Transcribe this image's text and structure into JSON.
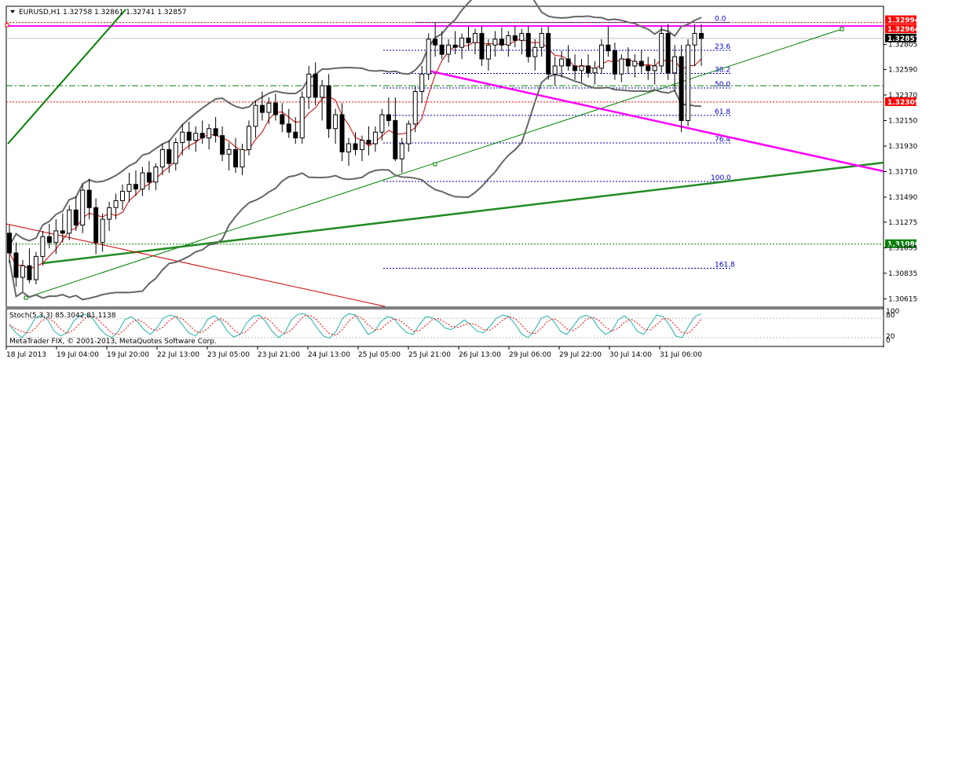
{
  "header": {
    "symbol_line": "EURUSD,H1  1.32758 1.32861 1.32741 1.32857",
    "collapse_arrow": "triangle-down-icon"
  },
  "footer": {
    "copyright": "MetaTrader FIX, © 2001-2013, MetaQuotes Software Corp."
  },
  "oscillator": {
    "label": "Stoch(5,3,3) 85.3042 81.1138",
    "levels": [
      "100",
      "80",
      "20",
      "0"
    ],
    "k_color": "#20b2aa",
    "d_color": "#ff0000",
    "k_values": [
      60,
      35,
      20,
      45,
      80,
      90,
      75,
      40,
      25,
      35,
      70,
      88,
      92,
      80,
      50,
      30,
      20,
      40,
      75,
      85,
      70,
      45,
      30,
      50,
      80,
      90,
      85,
      60,
      35,
      25,
      45,
      78,
      88,
      72,
      40,
      22,
      30,
      65,
      85,
      90,
      70,
      40,
      20,
      35,
      75,
      92,
      95,
      80,
      50,
      25,
      18,
      40,
      80,
      95,
      90,
      60,
      30,
      40,
      70,
      85,
      80,
      55,
      35,
      30,
      60,
      85,
      82,
      70,
      50,
      45,
      60,
      75,
      60,
      40,
      35,
      55,
      80,
      90,
      85,
      60,
      30,
      20,
      45,
      80,
      88,
      70,
      40,
      30,
      55,
      82,
      90,
      80,
      50,
      30,
      40,
      75,
      88,
      70,
      40,
      30,
      60,
      90,
      85,
      60,
      25,
      20,
      55,
      85,
      95
    ]
  },
  "chart_data": {
    "type": "candlestick",
    "title": "EURUSD,H1",
    "ohlc_readout": {
      "open": 1.32758,
      "high": 1.32861,
      "low": 1.32741,
      "close": 1.32857
    },
    "ylim": [
      1.3055,
      1.3312
    ],
    "y_ticks": [
      "1.32805",
      "1.32590",
      "1.32370",
      "1.32150",
      "1.31930",
      "1.31710",
      "1.31490",
      "1.31275",
      "1.31055",
      "1.30835",
      "1.30615"
    ],
    "x_ticks": [
      "18 Jul 2013",
      "19 Jul 04:00",
      "19 Jul 20:00",
      "22 Jul 13:00",
      "23 Jul 05:00",
      "23 Jul 21:00",
      "24 Jul 13:00",
      "25 Jul 05:00",
      "25 Jul 21:00",
      "26 Jul 13:00",
      "29 Jul 06:00",
      "29 Jul 22:00",
      "30 Jul 14:00",
      "31 Jul 06:00"
    ],
    "price_badges": [
      {
        "label": "1.32994",
        "value": 1.32994,
        "color": "#ff0000"
      },
      {
        "label": "1.32964",
        "value": 1.32964,
        "color": "#ff0000"
      },
      {
        "label": "1.32857",
        "value": 1.32857,
        "color": "#000000"
      },
      {
        "label": "1.32309",
        "value": 1.32309,
        "color": "#ff0000"
      },
      {
        "label": "1.31086",
        "value": 1.31086,
        "color": "#008000"
      }
    ],
    "horizontal_lines": [
      {
        "value": 1.32964,
        "color": "#ff00ff",
        "style": "solid",
        "width": 2
      },
      {
        "value": 1.32994,
        "color": "#ff0000",
        "style": "dotted",
        "width": 1
      },
      {
        "value": 1.32309,
        "color": "#ff0000",
        "style": "dotted",
        "width": 1
      },
      {
        "value": 1.3245,
        "color": "#008000",
        "style": "dashdot",
        "width": 1
      },
      {
        "value": 1.31086,
        "color": "#008000",
        "style": "dotted",
        "width": 1
      },
      {
        "value": 1.32857,
        "color": "#c0c0c0",
        "style": "solid",
        "width": 1
      }
    ],
    "fibonacci_levels": [
      {
        "label": "0.0",
        "value": 1.32994
      },
      {
        "label": "23.6",
        "value": 1.32755
      },
      {
        "label": "38.2",
        "value": 1.32555
      },
      {
        "label": "50.0",
        "value": 1.3243
      },
      {
        "label": "61.8",
        "value": 1.32194
      },
      {
        "label": "76.4",
        "value": 1.31957
      },
      {
        "label": "100.0",
        "value": 1.31625
      },
      {
        "label": "161.8",
        "value": 1.30878
      }
    ],
    "candles": [
      [
        1.3118,
        1.3125,
        1.3092,
        1.3101
      ],
      [
        1.3101,
        1.311,
        1.3072,
        1.308
      ],
      [
        1.308,
        1.3095,
        1.3068,
        1.309
      ],
      [
        1.309,
        1.3105,
        1.3075,
        1.3078
      ],
      [
        1.3078,
        1.3102,
        1.3074,
        1.3098
      ],
      [
        1.3098,
        1.312,
        1.309,
        1.3115
      ],
      [
        1.3115,
        1.3126,
        1.3105,
        1.311
      ],
      [
        1.311,
        1.313,
        1.31,
        1.312
      ],
      [
        1.312,
        1.3135,
        1.311,
        1.3118
      ],
      [
        1.3118,
        1.3142,
        1.3112,
        1.3138
      ],
      [
        1.3138,
        1.315,
        1.312,
        1.3125
      ],
      [
        1.3125,
        1.316,
        1.3118,
        1.3155
      ],
      [
        1.3155,
        1.3165,
        1.313,
        1.314
      ],
      [
        1.314,
        1.3148,
        1.31,
        1.311
      ],
      [
        1.311,
        1.3135,
        1.3102,
        1.313
      ],
      [
        1.313,
        1.3145,
        1.312,
        1.314
      ],
      [
        1.314,
        1.3152,
        1.313,
        1.3146
      ],
      [
        1.3146,
        1.316,
        1.3138,
        1.3154
      ],
      [
        1.3154,
        1.317,
        1.3145,
        1.316
      ],
      [
        1.316,
        1.3172,
        1.315,
        1.3156
      ],
      [
        1.3156,
        1.3175,
        1.315,
        1.317
      ],
      [
        1.317,
        1.318,
        1.3155,
        1.3162
      ],
      [
        1.3162,
        1.3178,
        1.3155,
        1.3175
      ],
      [
        1.3175,
        1.3195,
        1.3168,
        1.319
      ],
      [
        1.319,
        1.3198,
        1.317,
        1.3178
      ],
      [
        1.3178,
        1.32,
        1.3172,
        1.3196
      ],
      [
        1.3196,
        1.3212,
        1.3185,
        1.3205
      ],
      [
        1.3205,
        1.3214,
        1.319,
        1.3198
      ],
      [
        1.3198,
        1.321,
        1.3188,
        1.3204
      ],
      [
        1.3204,
        1.3215,
        1.3195,
        1.32
      ],
      [
        1.32,
        1.3212,
        1.319,
        1.3208
      ],
      [
        1.3208,
        1.3218,
        1.3196,
        1.3202
      ],
      [
        1.3202,
        1.321,
        1.318,
        1.3186
      ],
      [
        1.3186,
        1.3196,
        1.3172,
        1.319
      ],
      [
        1.319,
        1.32,
        1.317,
        1.3175
      ],
      [
        1.3175,
        1.3195,
        1.3168,
        1.319
      ],
      [
        1.319,
        1.3215,
        1.3185,
        1.321
      ],
      [
        1.321,
        1.3232,
        1.32,
        1.3228
      ],
      [
        1.3228,
        1.324,
        1.3215,
        1.3222
      ],
      [
        1.3222,
        1.3235,
        1.3212,
        1.323
      ],
      [
        1.323,
        1.3238,
        1.3215,
        1.322
      ],
      [
        1.322,
        1.323,
        1.3205,
        1.3212
      ],
      [
        1.3212,
        1.3225,
        1.32,
        1.3205
      ],
      [
        1.3205,
        1.3218,
        1.3195,
        1.32
      ],
      [
        1.32,
        1.324,
        1.3195,
        1.3235
      ],
      [
        1.3235,
        1.3262,
        1.3225,
        1.3255
      ],
      [
        1.3255,
        1.3265,
        1.3228,
        1.3235
      ],
      [
        1.3235,
        1.325,
        1.3215,
        1.3245
      ],
      [
        1.3245,
        1.3255,
        1.32,
        1.3208
      ],
      [
        1.3208,
        1.3225,
        1.3195,
        1.322
      ],
      [
        1.322,
        1.323,
        1.318,
        1.3188
      ],
      [
        1.3188,
        1.32,
        1.3176,
        1.3195
      ],
      [
        1.3195,
        1.3205,
        1.3185,
        1.319
      ],
      [
        1.319,
        1.3202,
        1.318,
        1.3198
      ],
      [
        1.3198,
        1.321,
        1.3185,
        1.3195
      ],
      [
        1.3195,
        1.321,
        1.3188,
        1.3205
      ],
      [
        1.3205,
        1.3225,
        1.3198,
        1.322
      ],
      [
        1.322,
        1.3235,
        1.321,
        1.3215
      ],
      [
        1.3215,
        1.3235,
        1.318,
        1.3182
      ],
      [
        1.3182,
        1.32,
        1.317,
        1.3195
      ],
      [
        1.3195,
        1.3215,
        1.3188,
        1.3212
      ],
      [
        1.3212,
        1.3245,
        1.3205,
        1.324
      ],
      [
        1.324,
        1.3262,
        1.323,
        1.3255
      ],
      [
        1.3255,
        1.329,
        1.325,
        1.3285
      ],
      [
        1.3285,
        1.3299,
        1.327,
        1.328
      ],
      [
        1.328,
        1.3292,
        1.3268,
        1.3272
      ],
      [
        1.3272,
        1.3285,
        1.3265,
        1.328
      ],
      [
        1.328,
        1.3292,
        1.3272,
        1.3278
      ],
      [
        1.3278,
        1.329,
        1.3268,
        1.3286
      ],
      [
        1.3286,
        1.3296,
        1.3276,
        1.3282
      ],
      [
        1.3282,
        1.3294,
        1.3272,
        1.329
      ],
      [
        1.329,
        1.3296,
        1.3262,
        1.3268
      ],
      [
        1.3268,
        1.3285,
        1.3258,
        1.328
      ],
      [
        1.328,
        1.3292,
        1.327,
        1.3285
      ],
      [
        1.3285,
        1.3295,
        1.3275,
        1.328
      ],
      [
        1.328,
        1.3292,
        1.327,
        1.3288
      ],
      [
        1.3288,
        1.3296,
        1.3278,
        1.3284
      ],
      [
        1.3284,
        1.3294,
        1.3272,
        1.329
      ],
      [
        1.329,
        1.3296,
        1.3265,
        1.327
      ],
      [
        1.327,
        1.3285,
        1.3258,
        1.3278
      ],
      [
        1.3278,
        1.3295,
        1.327,
        1.329
      ],
      [
        1.329,
        1.3296,
        1.325,
        1.3255
      ],
      [
        1.3255,
        1.327,
        1.3245,
        1.3262
      ],
      [
        1.3262,
        1.3275,
        1.3252,
        1.3268
      ],
      [
        1.3268,
        1.328,
        1.3258,
        1.3262
      ],
      [
        1.3262,
        1.3272,
        1.325,
        1.3258
      ],
      [
        1.3258,
        1.3268,
        1.3248,
        1.3262
      ],
      [
        1.3262,
        1.3272,
        1.3252,
        1.3256
      ],
      [
        1.3256,
        1.3266,
        1.3246,
        1.326
      ],
      [
        1.326,
        1.3285,
        1.3255,
        1.328
      ],
      [
        1.328,
        1.3296,
        1.327,
        1.3275
      ],
      [
        1.3275,
        1.3282,
        1.325,
        1.3255
      ],
      [
        1.3255,
        1.3272,
        1.3248,
        1.3268
      ],
      [
        1.3268,
        1.3278,
        1.3255,
        1.3262
      ],
      [
        1.3262,
        1.3272,
        1.3252,
        1.3266
      ],
      [
        1.3266,
        1.3276,
        1.3256,
        1.3262
      ],
      [
        1.3262,
        1.327,
        1.325,
        1.3258
      ],
      [
        1.3258,
        1.3268,
        1.3246,
        1.3262
      ],
      [
        1.3262,
        1.3296,
        1.3256,
        1.329
      ],
      [
        1.329,
        1.3298,
        1.325,
        1.3256
      ],
      [
        1.3256,
        1.328,
        1.324,
        1.327
      ],
      [
        1.327,
        1.328,
        1.3205,
        1.3215
      ],
      [
        1.3215,
        1.3285,
        1.321,
        1.328
      ],
      [
        1.328,
        1.3298,
        1.3262,
        1.329
      ],
      [
        1.329,
        1.3298,
        1.3262,
        1.32857
      ]
    ]
  }
}
